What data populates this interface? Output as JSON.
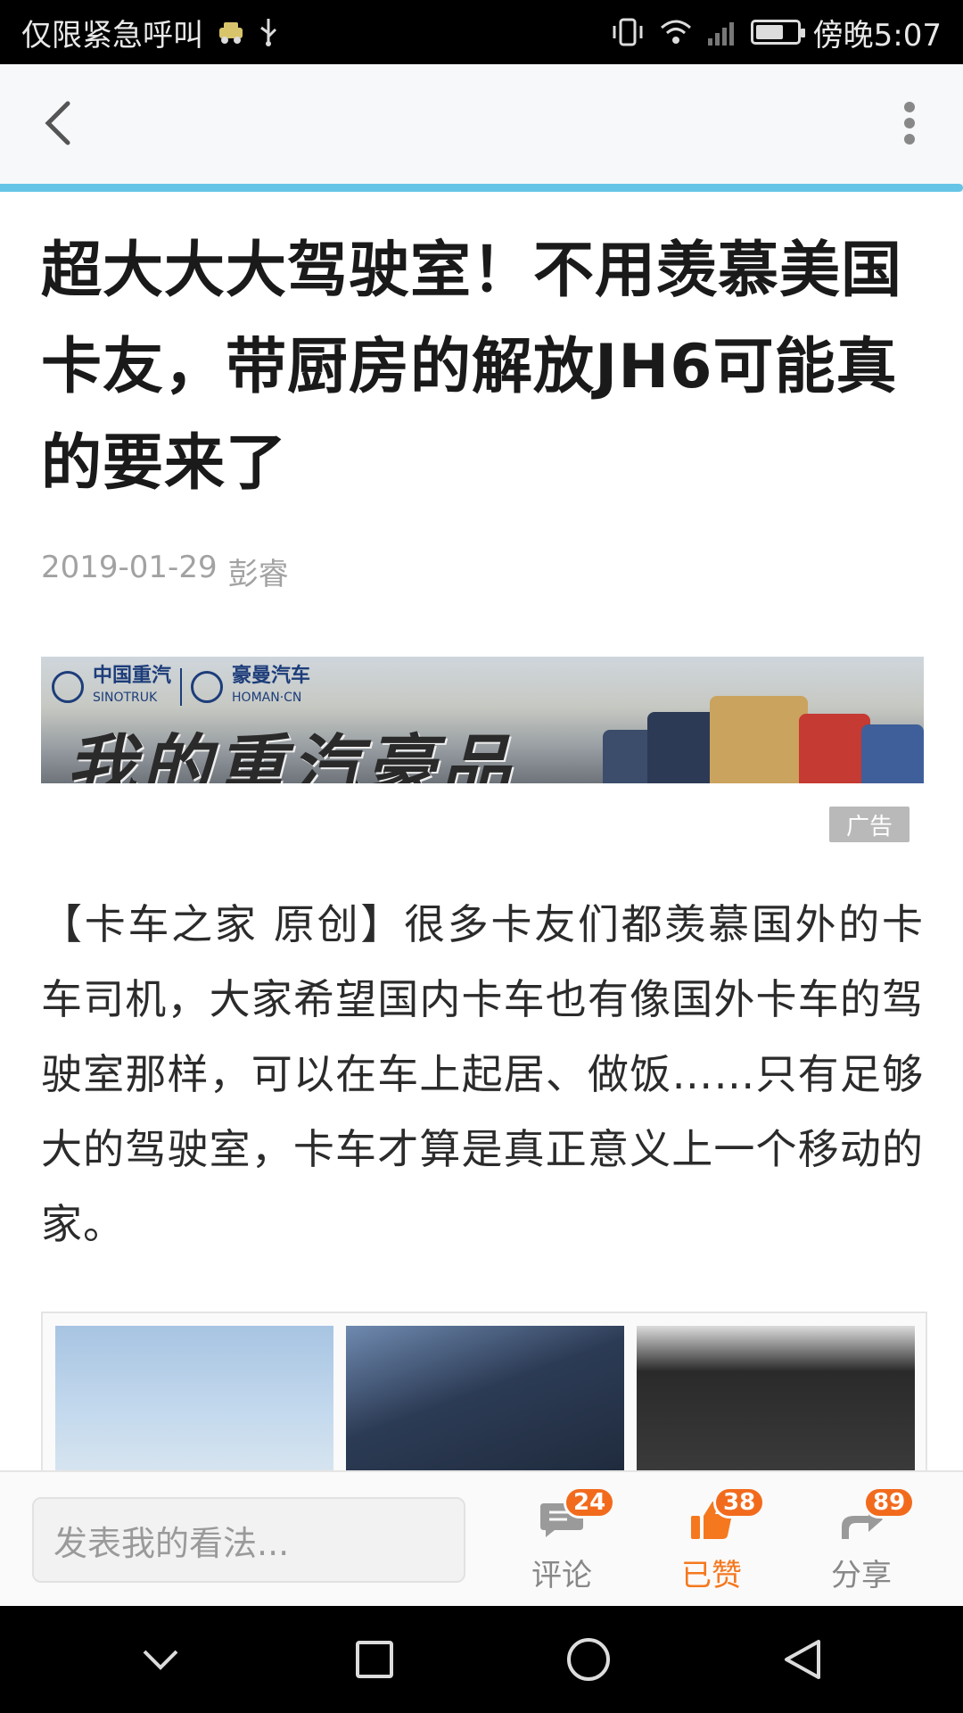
{
  "status_bar": {
    "carrier": "仅限紧急呼叫",
    "time": "傍晚5:07"
  },
  "header": {
    "progress_fraction": 1.0,
    "colors": {
      "progress": "#66c5e6",
      "background": "#f7f8fa"
    }
  },
  "article": {
    "title": "超大大大驾驶室！不用羡慕美国卡友，带厨房的解放JH6可能真的要来了",
    "date": "2019-01-29",
    "author": "彭睿",
    "ad": {
      "brand_a": "中国重汽",
      "brand_a_en": "SINOTRUK",
      "brand_b": "豪曼汽车",
      "brand_b_en": "HOMAN·CN",
      "slogan": "我的重汽豪品",
      "badge": "广告"
    },
    "paragraph": "【卡车之家 原创】很多卡友们都羡慕国外的卡车司机，大家希望国内卡车也有像国外卡车的驾驶室那样，可以在车上起居、做饭……只有足够大的驾驶室，卡车才算是真正意义上一个移动的家。"
  },
  "action_bar": {
    "comment_placeholder": "发表我的看法...",
    "comment": {
      "label": "评论",
      "count": "24"
    },
    "like": {
      "label": "已赞",
      "count": "38"
    },
    "share": {
      "label": "分享",
      "count": "89"
    },
    "colors": {
      "accent": "#f5781e",
      "badge": "#f26b1d",
      "inactive": "#888888"
    }
  }
}
